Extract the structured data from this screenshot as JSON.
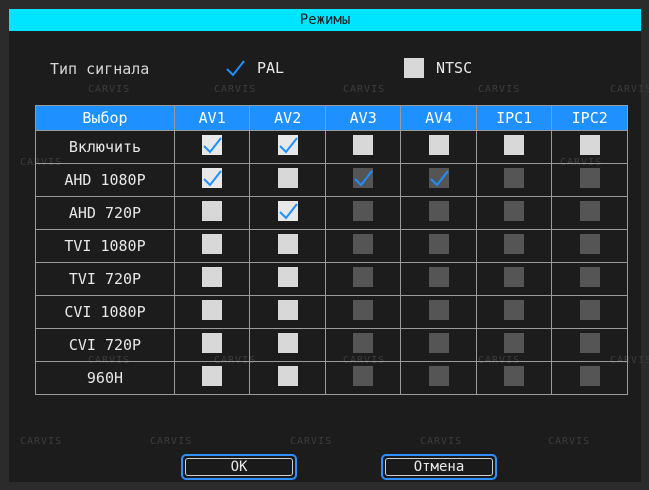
{
  "title": "Режимы",
  "signal": {
    "label": "Тип сигнала",
    "options": [
      {
        "label": "PAL",
        "checked": true
      },
      {
        "label": "NTSC",
        "checked": false
      }
    ]
  },
  "table": {
    "header": [
      "Выбор",
      "AV1",
      "AV2",
      "AV3",
      "AV4",
      "IPC1",
      "IPC2"
    ],
    "rows": [
      {
        "label": "Включить",
        "cells": [
          "checked",
          "checked",
          "on",
          "on",
          "on",
          "on"
        ]
      },
      {
        "label": "AHD 1080P",
        "cells": [
          "checked",
          "on",
          "checked-dim",
          "checked-dim",
          "dim",
          "dim"
        ]
      },
      {
        "label": "AHD 720P",
        "cells": [
          "on",
          "checked",
          "dim",
          "dim",
          "dim",
          "dim"
        ]
      },
      {
        "label": "TVI 1080P",
        "cells": [
          "on",
          "on",
          "dim",
          "dim",
          "dim",
          "dim"
        ]
      },
      {
        "label": "TVI 720P",
        "cells": [
          "on",
          "on",
          "dim",
          "dim",
          "dim",
          "dim"
        ]
      },
      {
        "label": "CVI 1080P",
        "cells": [
          "on",
          "on",
          "dim",
          "dim",
          "dim",
          "dim"
        ]
      },
      {
        "label": "CVI 720P",
        "cells": [
          "on",
          "on",
          "dim",
          "dim",
          "dim",
          "dim"
        ]
      },
      {
        "label": "960H",
        "cells": [
          "on",
          "on",
          "dim",
          "dim",
          "dim",
          "dim"
        ]
      }
    ]
  },
  "buttons": {
    "ok": "OK",
    "cancel": "Отмена"
  },
  "watermark": "CARVIS",
  "colors": {
    "title_bar": "#00e5ff",
    "header_row": "#1e90ff",
    "check": "#1e90ff",
    "button_border": "#2f8fff"
  }
}
